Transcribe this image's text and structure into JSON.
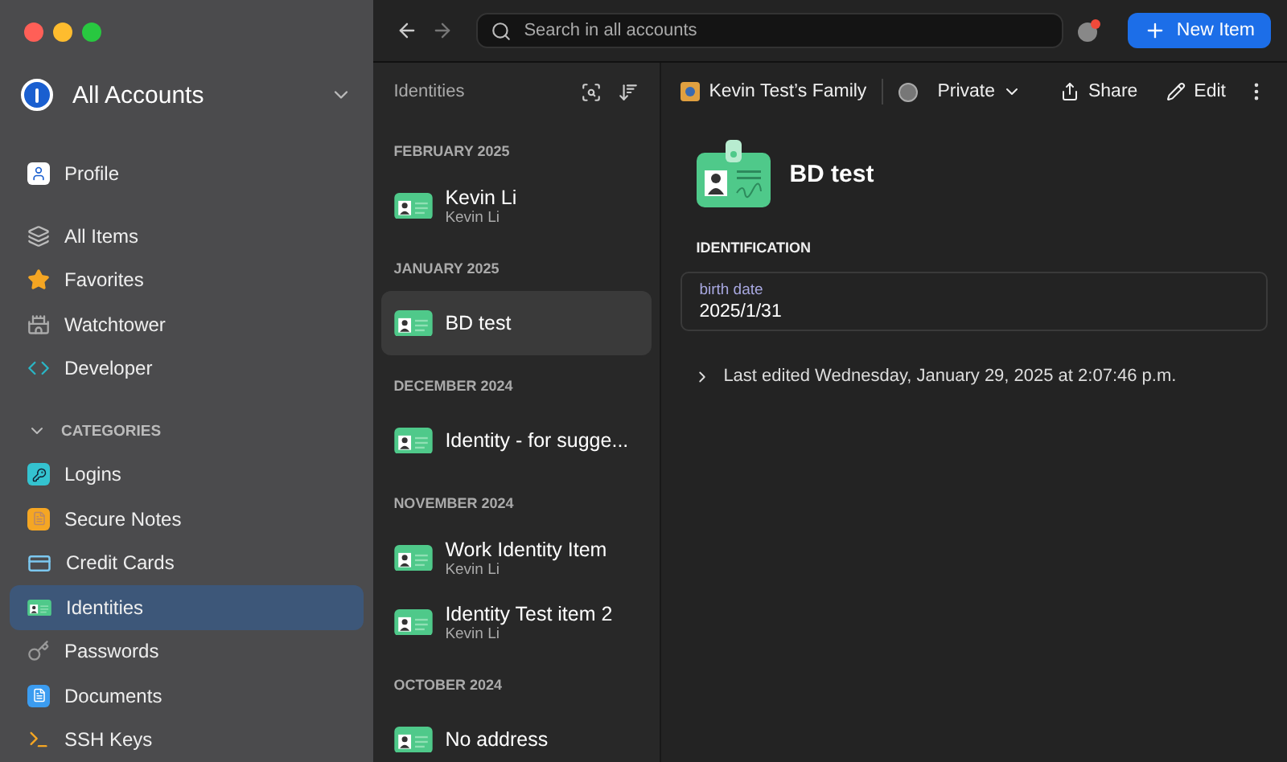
{
  "sidebar": {
    "account": "All Accounts",
    "top_items": [
      {
        "label": "Profile",
        "selected": false
      }
    ],
    "items": [
      {
        "label": "All Items",
        "selected": false
      },
      {
        "label": "Favorites",
        "selected": false
      },
      {
        "label": "Watchtower",
        "selected": false
      },
      {
        "label": "Developer",
        "selected": false
      }
    ],
    "categories": {
      "title": "CATEGORIES",
      "expanded": true,
      "items": [
        {
          "label": "Logins",
          "selected": false
        },
        {
          "label": "Secure Notes",
          "selected": false
        },
        {
          "label": "Credit Cards",
          "selected": false
        },
        {
          "label": "Identities",
          "selected": true
        },
        {
          "label": "Passwords",
          "selected": false
        },
        {
          "label": "Documents",
          "selected": false
        },
        {
          "label": "SSH Keys",
          "selected": false
        }
      ]
    }
  },
  "toolbar": {
    "search": {
      "placeholder": "Search in all accounts"
    },
    "new_item": "New Item"
  },
  "list": {
    "title": "Identities",
    "groups": [
      {
        "heading": "FEBRUARY 2025",
        "items": [
          {
            "title": "Kevin Li",
            "subtitle": "Kevin Li",
            "selected": false
          }
        ]
      },
      {
        "heading": "JANUARY 2025",
        "items": [
          {
            "title": "BD test",
            "selected": true
          }
        ]
      },
      {
        "heading": "DECEMBER 2024",
        "items": [
          {
            "title": "Identity - for sugge...",
            "selected": false
          }
        ]
      },
      {
        "heading": "NOVEMBER 2024",
        "items": [
          {
            "title": "Work Identity Item",
            "subtitle": "Kevin Li",
            "selected": false
          },
          {
            "title": "Identity Test item 2",
            "subtitle": "Kevin Li",
            "selected": false
          }
        ]
      },
      {
        "heading": "OCTOBER 2024",
        "items": [
          {
            "title": "No address",
            "selected": false
          }
        ]
      }
    ]
  },
  "detail": {
    "vault": "Kevin Test’s Family",
    "privacy": "Private",
    "actions": [
      "Share",
      "Edit"
    ],
    "title": "BD test",
    "section": "IDENTIFICATION",
    "fields": [
      {
        "label": "birth date",
        "value": "2025/1/31"
      }
    ],
    "last_edited": "Last edited Wednesday, January 29, 2025 at 2:07:46 p.m."
  }
}
